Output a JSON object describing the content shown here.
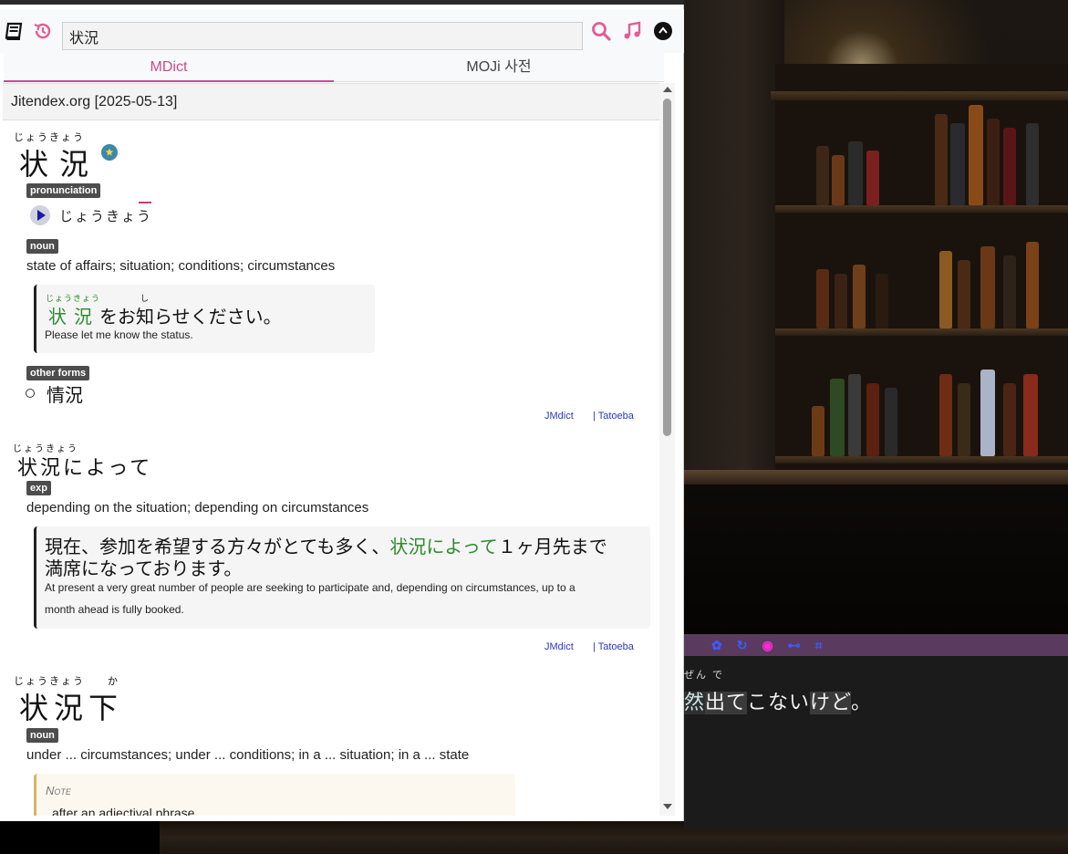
{
  "toolbar": {
    "search_value": "状況",
    "tabs": [
      {
        "label": "MDict",
        "active": true
      },
      {
        "label": "MOJi 사전",
        "active": false
      }
    ],
    "icons": [
      "book-icon",
      "history-icon",
      "search-icon",
      "music-note-icon",
      "collapse-up-icon"
    ],
    "accent_color": "#cc4a8a"
  },
  "dictionary": {
    "title": "Jitendex.org [2025-05-13]",
    "entries": [
      {
        "reading": "じょうきょう",
        "headword": "状況",
        "tags": [
          "pronunciation",
          "noun",
          "other forms"
        ],
        "pronunciation": "じょうきょう",
        "gloss": "state of affairs; situation; conditions; circumstances",
        "example": {
          "ruby_1": "じょうきょう",
          "ruby_2": "し",
          "jp_head": "状況",
          "jp_rest": "をお知らせください。",
          "en": "Please let me know the status."
        },
        "other_forms": [
          "情況"
        ],
        "sources": [
          "JMdict",
          "| Tatoeba"
        ]
      },
      {
        "reading": "じょうきょう",
        "headword": "状況によって",
        "tags": [
          "exp"
        ],
        "gloss": "depending on the situation; depending on circumstances",
        "example": {
          "jp_before": "現在、参加を希望する方々がとても多く、",
          "jp_green": "状況によって",
          "jp_after": "１ヶ月先まで",
          "jp_line2": "満席になっております。",
          "en_line1": "At present a very great number of people are seeking to participate and, depending on circumstances, up to a",
          "en_line2": "month ahead is fully booked."
        },
        "sources": [
          "JMdict",
          "| Tatoeba"
        ]
      },
      {
        "reading": "じょうきょう",
        "reading_2": "か",
        "headword": "状況下",
        "tags": [
          "noun"
        ],
        "gloss": "under ... circumstances; under ... conditions; in a ... situation; in a ... state",
        "note_label": "Note",
        "note_text": "after an adjectival phrase"
      }
    ]
  },
  "reader": {
    "ruby": "ぜん で",
    "line_part1": "然",
    "line_part2": "出て",
    "line_part3": "こない",
    "line_part4": "けど",
    "line_part5": "。",
    "toolbar_icons": [
      "settings-icon",
      "refresh-icon",
      "eye-icon",
      "link-icon",
      "crop-icon"
    ],
    "icon_colors": [
      "#3d5afe",
      "#3d5afe",
      "#ff2bd6",
      "#3d5afe",
      "#3d5afe"
    ]
  }
}
